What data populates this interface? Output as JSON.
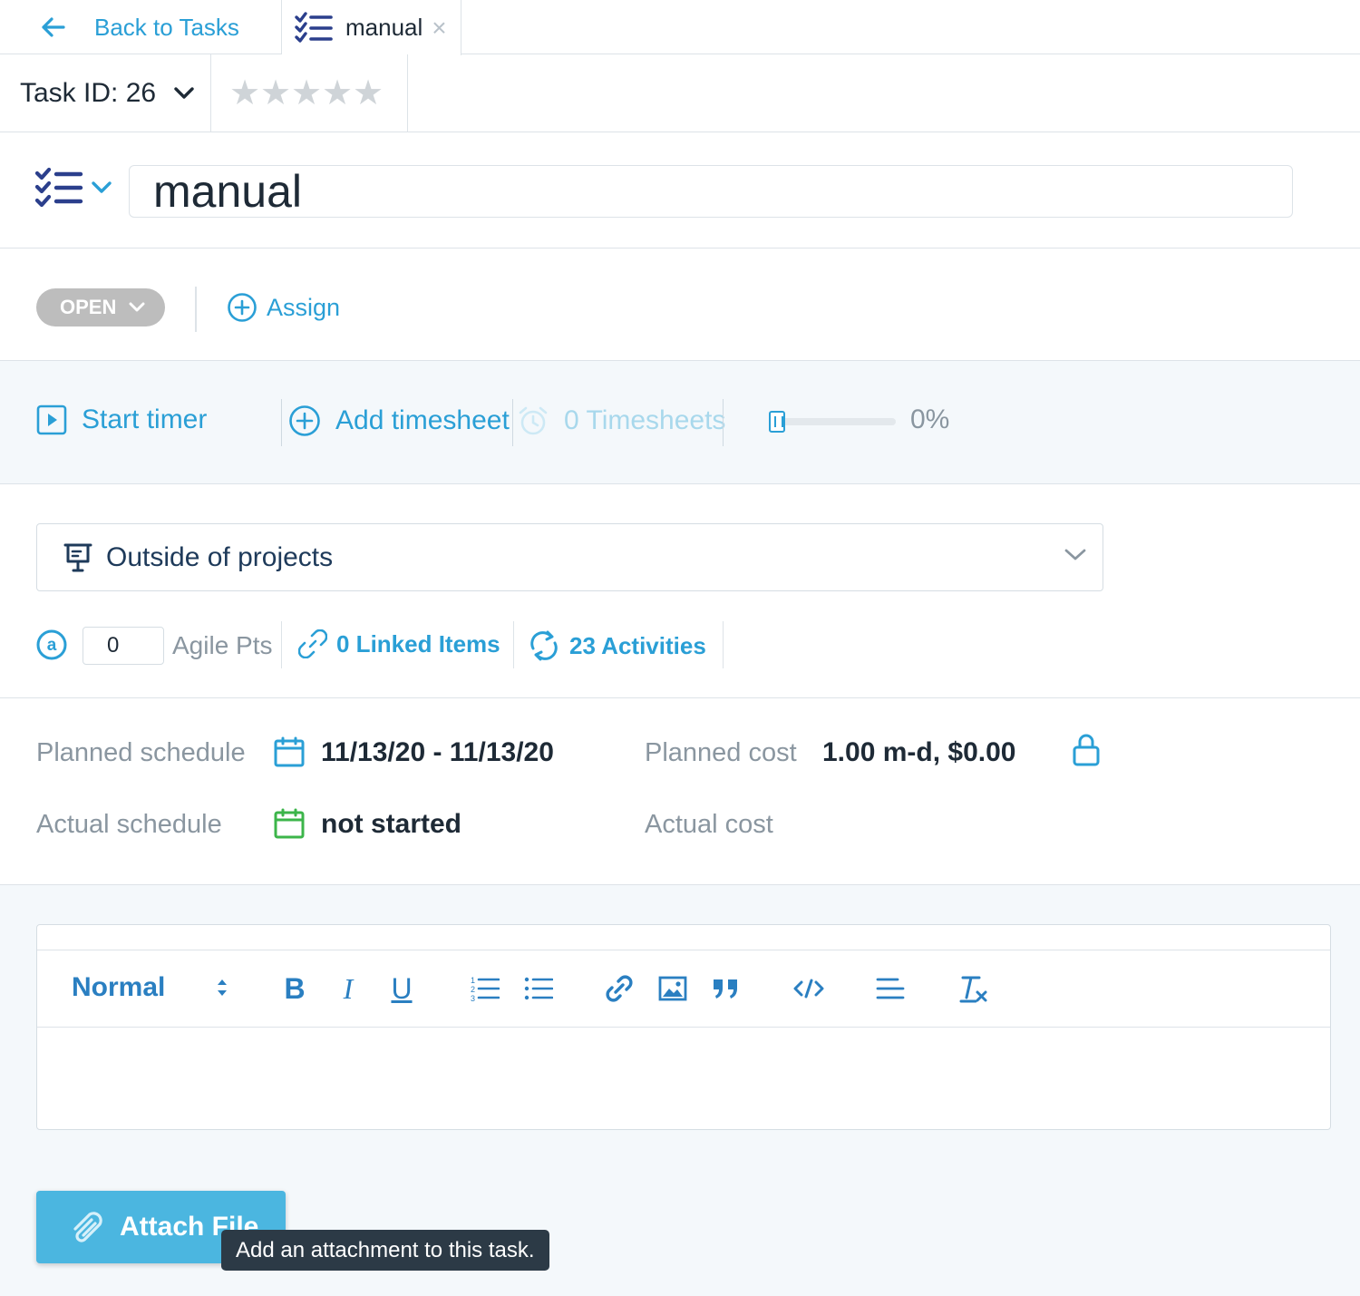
{
  "tabs": {
    "back_label": "Back to Tasks",
    "task_tab_label": "manual",
    "close_glyph": "×"
  },
  "task": {
    "id_label": "Task ID: 26",
    "rating": {
      "value": 0,
      "max": 5
    },
    "title": "manual",
    "status": "OPEN",
    "assign_label": "Assign"
  },
  "timer": {
    "start_label": "Start timer",
    "add_timesheet_label": "Add timesheet",
    "timesheets_label": "0 Timesheets",
    "progress_percent": 0,
    "progress_label": "0%"
  },
  "project": {
    "label": "Outside of projects"
  },
  "meta": {
    "agile_value": "0",
    "agile_label": "Agile Pts",
    "linked_label": "0 Linked Items",
    "activities_label": "23 Activities"
  },
  "schedule": {
    "planned_schedule_label": "Planned schedule",
    "planned_schedule_value": "11/13/20 - 11/13/20",
    "actual_schedule_label": "Actual schedule",
    "actual_schedule_value": "not started",
    "planned_cost_label": "Planned cost",
    "planned_cost_value": "1.00 m-d, $0.00",
    "actual_cost_label": "Actual cost"
  },
  "editor": {
    "format_label": "Normal",
    "bold": "B",
    "italic": "I",
    "underline": "U"
  },
  "attach": {
    "button_label": "Attach File",
    "tooltip": "Add an attachment to this task."
  },
  "colors": {
    "accent": "#2a9fd6",
    "status_gray": "#bdbdbd",
    "button": "#4bb6e0",
    "green": "#3cb54a",
    "navy": "#2b3f8c"
  }
}
